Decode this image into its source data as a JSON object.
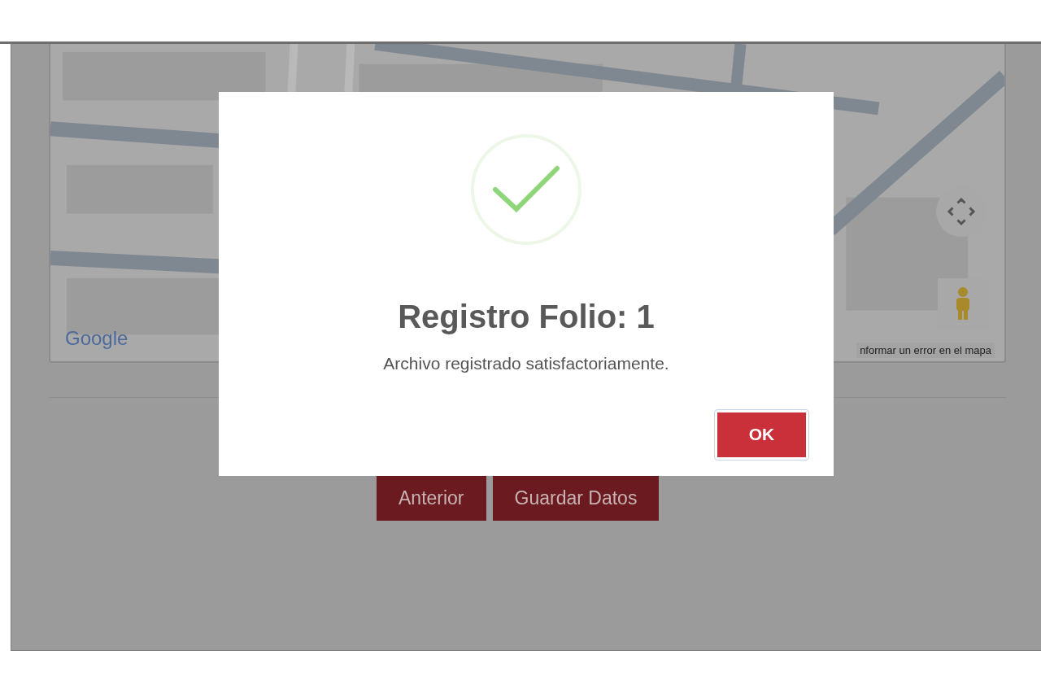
{
  "map": {
    "logo": "Google",
    "error_link": "nformar un error en el mapa"
  },
  "buttons": [
    {
      "label": "Anterior"
    },
    {
      "label": "Guardar Datos"
    }
  ],
  "dialog": {
    "title": "Registro Folio: 1",
    "message": "Archivo registrado satisfactoriamente.",
    "confirm": "OK"
  }
}
